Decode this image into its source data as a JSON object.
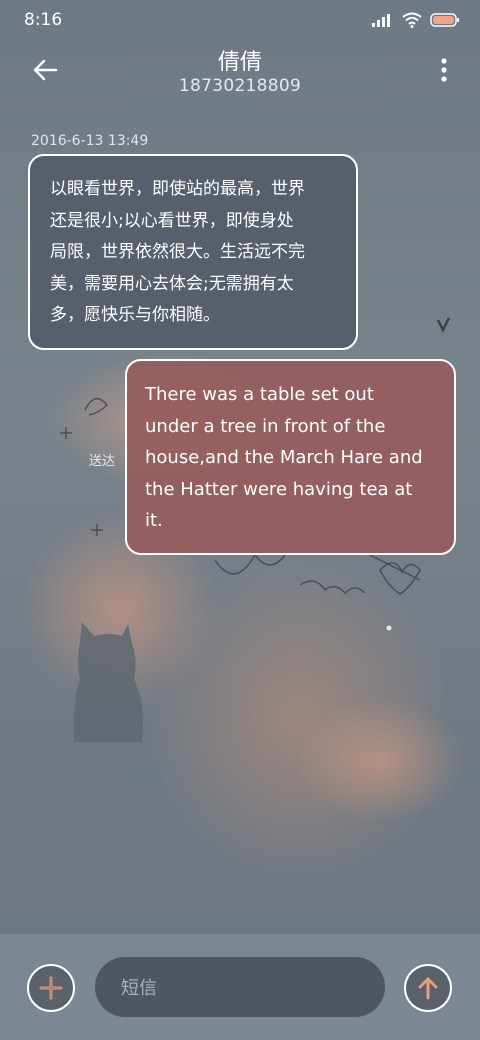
{
  "status_bar": {
    "time": "8:16",
    "icons": [
      "signal-icon",
      "wifi-icon",
      "battery-icon"
    ]
  },
  "header": {
    "contact_name": "倩倩",
    "phone_number": "18730218809",
    "back_icon": "arrow-left-icon",
    "menu_icon": "more-vertical-icon"
  },
  "conversation": {
    "timestamp": "2016-6-13 13:49",
    "messages": [
      {
        "direction": "incoming",
        "lines": [
          "以眼看世界，即使站的最高，世界",
          "还是很小;以心看世界，即使身处",
          "局限，世界依然很大。生活远不完",
          "美，需要用心去体会;无需拥有太",
          "多，愿快乐与你相随。"
        ]
      },
      {
        "direction": "outgoing",
        "lines": [
          "There was a table set out",
          "under a tree in front of the",
          "house,and the March Hare and",
          "the Hatter were having tea at",
          "it."
        ]
      }
    ],
    "status_label": "送达"
  },
  "composer": {
    "placeholder": "短信",
    "add_icon": "plus-icon",
    "send_icon": "arrow-up-icon"
  },
  "colors": {
    "incoming_bubble": "#545c68",
    "outgoing_bubble": "#965c5c",
    "bottom_bar": "#7c8793",
    "input_bg": "#4e5661"
  }
}
